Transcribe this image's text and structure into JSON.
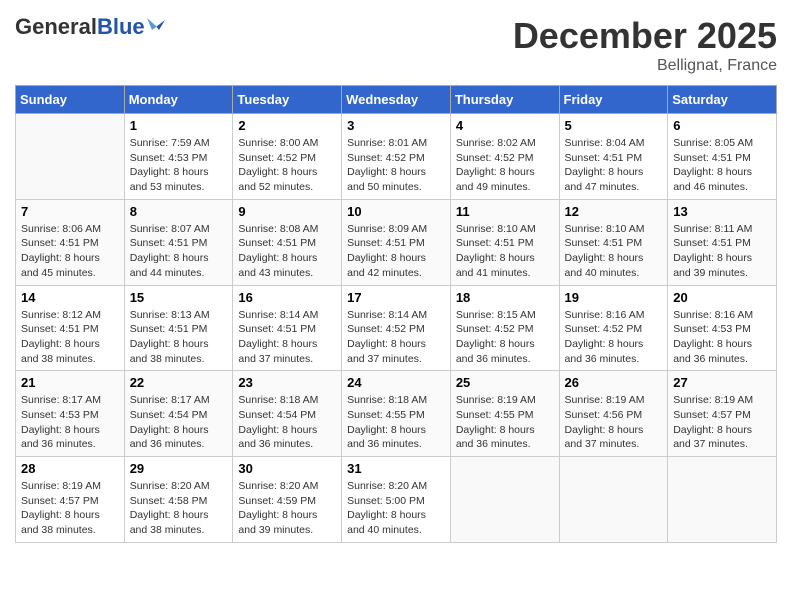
{
  "header": {
    "logo_general": "General",
    "logo_blue": "Blue",
    "month": "December 2025",
    "location": "Bellignat, France"
  },
  "days_of_week": [
    "Sunday",
    "Monday",
    "Tuesday",
    "Wednesday",
    "Thursday",
    "Friday",
    "Saturday"
  ],
  "weeks": [
    [
      {
        "day": "",
        "info": ""
      },
      {
        "day": "1",
        "info": "Sunrise: 7:59 AM\nSunset: 4:53 PM\nDaylight: 8 hours\nand 53 minutes."
      },
      {
        "day": "2",
        "info": "Sunrise: 8:00 AM\nSunset: 4:52 PM\nDaylight: 8 hours\nand 52 minutes."
      },
      {
        "day": "3",
        "info": "Sunrise: 8:01 AM\nSunset: 4:52 PM\nDaylight: 8 hours\nand 50 minutes."
      },
      {
        "day": "4",
        "info": "Sunrise: 8:02 AM\nSunset: 4:52 PM\nDaylight: 8 hours\nand 49 minutes."
      },
      {
        "day": "5",
        "info": "Sunrise: 8:04 AM\nSunset: 4:51 PM\nDaylight: 8 hours\nand 47 minutes."
      },
      {
        "day": "6",
        "info": "Sunrise: 8:05 AM\nSunset: 4:51 PM\nDaylight: 8 hours\nand 46 minutes."
      }
    ],
    [
      {
        "day": "7",
        "info": "Sunrise: 8:06 AM\nSunset: 4:51 PM\nDaylight: 8 hours\nand 45 minutes."
      },
      {
        "day": "8",
        "info": "Sunrise: 8:07 AM\nSunset: 4:51 PM\nDaylight: 8 hours\nand 44 minutes."
      },
      {
        "day": "9",
        "info": "Sunrise: 8:08 AM\nSunset: 4:51 PM\nDaylight: 8 hours\nand 43 minutes."
      },
      {
        "day": "10",
        "info": "Sunrise: 8:09 AM\nSunset: 4:51 PM\nDaylight: 8 hours\nand 42 minutes."
      },
      {
        "day": "11",
        "info": "Sunrise: 8:10 AM\nSunset: 4:51 PM\nDaylight: 8 hours\nand 41 minutes."
      },
      {
        "day": "12",
        "info": "Sunrise: 8:10 AM\nSunset: 4:51 PM\nDaylight: 8 hours\nand 40 minutes."
      },
      {
        "day": "13",
        "info": "Sunrise: 8:11 AM\nSunset: 4:51 PM\nDaylight: 8 hours\nand 39 minutes."
      }
    ],
    [
      {
        "day": "14",
        "info": "Sunrise: 8:12 AM\nSunset: 4:51 PM\nDaylight: 8 hours\nand 38 minutes."
      },
      {
        "day": "15",
        "info": "Sunrise: 8:13 AM\nSunset: 4:51 PM\nDaylight: 8 hours\nand 38 minutes."
      },
      {
        "day": "16",
        "info": "Sunrise: 8:14 AM\nSunset: 4:51 PM\nDaylight: 8 hours\nand 37 minutes."
      },
      {
        "day": "17",
        "info": "Sunrise: 8:14 AM\nSunset: 4:52 PM\nDaylight: 8 hours\nand 37 minutes."
      },
      {
        "day": "18",
        "info": "Sunrise: 8:15 AM\nSunset: 4:52 PM\nDaylight: 8 hours\nand 36 minutes."
      },
      {
        "day": "19",
        "info": "Sunrise: 8:16 AM\nSunset: 4:52 PM\nDaylight: 8 hours\nand 36 minutes."
      },
      {
        "day": "20",
        "info": "Sunrise: 8:16 AM\nSunset: 4:53 PM\nDaylight: 8 hours\nand 36 minutes."
      }
    ],
    [
      {
        "day": "21",
        "info": "Sunrise: 8:17 AM\nSunset: 4:53 PM\nDaylight: 8 hours\nand 36 minutes."
      },
      {
        "day": "22",
        "info": "Sunrise: 8:17 AM\nSunset: 4:54 PM\nDaylight: 8 hours\nand 36 minutes."
      },
      {
        "day": "23",
        "info": "Sunrise: 8:18 AM\nSunset: 4:54 PM\nDaylight: 8 hours\nand 36 minutes."
      },
      {
        "day": "24",
        "info": "Sunrise: 8:18 AM\nSunset: 4:55 PM\nDaylight: 8 hours\nand 36 minutes."
      },
      {
        "day": "25",
        "info": "Sunrise: 8:19 AM\nSunset: 4:55 PM\nDaylight: 8 hours\nand 36 minutes."
      },
      {
        "day": "26",
        "info": "Sunrise: 8:19 AM\nSunset: 4:56 PM\nDaylight: 8 hours\nand 37 minutes."
      },
      {
        "day": "27",
        "info": "Sunrise: 8:19 AM\nSunset: 4:57 PM\nDaylight: 8 hours\nand 37 minutes."
      }
    ],
    [
      {
        "day": "28",
        "info": "Sunrise: 8:19 AM\nSunset: 4:57 PM\nDaylight: 8 hours\nand 38 minutes."
      },
      {
        "day": "29",
        "info": "Sunrise: 8:20 AM\nSunset: 4:58 PM\nDaylight: 8 hours\nand 38 minutes."
      },
      {
        "day": "30",
        "info": "Sunrise: 8:20 AM\nSunset: 4:59 PM\nDaylight: 8 hours\nand 39 minutes."
      },
      {
        "day": "31",
        "info": "Sunrise: 8:20 AM\nSunset: 5:00 PM\nDaylight: 8 hours\nand 40 minutes."
      },
      {
        "day": "",
        "info": ""
      },
      {
        "day": "",
        "info": ""
      },
      {
        "day": "",
        "info": ""
      }
    ]
  ]
}
